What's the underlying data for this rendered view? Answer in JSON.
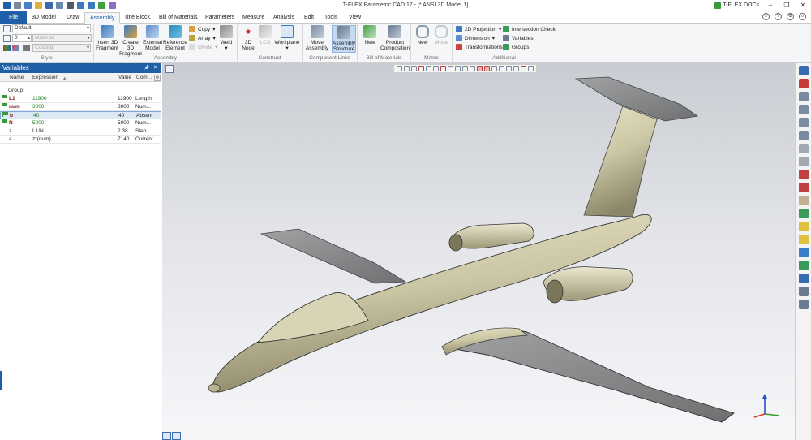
{
  "window": {
    "title": "T-FLEX Parametric CAD 17 - [* ANSI 3D Model 1]",
    "docs_label": "T-FLEX DOCs",
    "minimize": "–",
    "restore": "❐",
    "close": "✕"
  },
  "menu": {
    "file": "File",
    "tabs": [
      "3D Model",
      "Draw",
      "Assembly",
      "Title Block",
      "Bill of Materials",
      "Parameters",
      "Measure",
      "Analysis",
      "Edit",
      "Tools",
      "View"
    ],
    "active_tab": "Assembly"
  },
  "ribbon": {
    "style_group": {
      "label": "Style",
      "style_value": "Default",
      "layer_value": "0",
      "material_placeholder": "Material",
      "coating_placeholder": "Coating"
    },
    "assembly_group": {
      "label": "Assembly",
      "insert_3d_fragment": "Insert 3D Fragment",
      "create_3d_fragment": "Create 3D Fragment",
      "external_model": "External Model",
      "reference_element": "Reference Element",
      "copy": "Copy",
      "array": "Array",
      "divide": "Divide",
      "weld": "Weld"
    },
    "construct_group": {
      "label": "Construct",
      "node_3d": "3D Node",
      "lcs": "LCS",
      "workplane": "Workplane"
    },
    "component_links_group": {
      "label": "Component Links",
      "move_assembly": "Move Assembly",
      "assembly_structure": "Assembly Structure"
    },
    "bom_group": {
      "label": "Bill of Materials",
      "new": "New",
      "product_composition": "Product Composition"
    },
    "mates_group": {
      "label": "Mates",
      "new": "New",
      "move": "Move"
    },
    "additional_group": {
      "label": "Additional",
      "projection_2d": "2D Projection",
      "dimension": "Dimension",
      "transformations": "Transformations",
      "intersection_check": "Intersection Check",
      "variables": "Variables",
      "groups": "Groups"
    }
  },
  "variables_panel": {
    "title": "Variables",
    "pin": "🖈",
    "close": "✕",
    "columns": [
      "Name",
      "Expression",
      "Value",
      "Com..."
    ],
    "group_label": "Group:",
    "rows": [
      {
        "name": "L1",
        "expression": "11900",
        "value": "11900",
        "comment": "Length",
        "style": "darkred",
        "flag": true
      },
      {
        "name": "num",
        "expression": "3000",
        "value": "3000",
        "comment": "Num...",
        "style": "darkred",
        "flag": true
      },
      {
        "name": "b",
        "expression": "40",
        "value": "40",
        "comment": "Absent",
        "style": "darkred",
        "flag": true,
        "selected": true
      },
      {
        "name": "N",
        "expression": "5000",
        "value": "5000",
        "comment": "Num...",
        "style": "darkred",
        "flag": true
      },
      {
        "name": "z",
        "expression": "L1/N",
        "value": "2.38",
        "comment": "Step",
        "style": "plain",
        "flag": false
      },
      {
        "name": "a",
        "expression": "z*(num)",
        "value": "7140",
        "comment": "Current",
        "style": "plain",
        "flag": false
      }
    ]
  },
  "viewport": {
    "model": "aircraft-3d-model",
    "axis_colors": {
      "x": "#d03030",
      "y": "#2e9a2e",
      "z": "#2a4fd0"
    }
  },
  "colors": {
    "accent": "#1e5fa8",
    "fuselage": "#cbc6a4",
    "wing": "#8a8c8e"
  }
}
